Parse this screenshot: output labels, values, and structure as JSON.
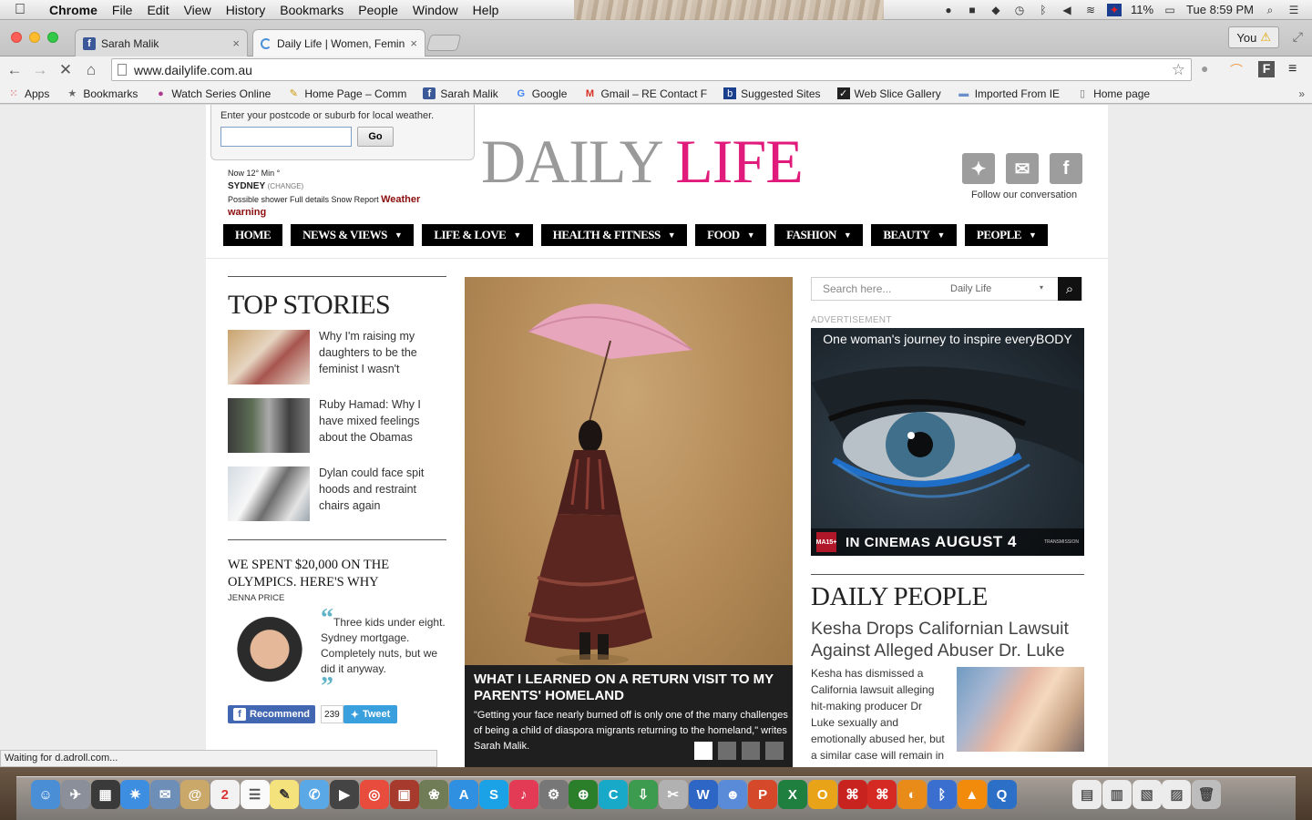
{
  "menubar": {
    "app": "Chrome",
    "items": [
      "File",
      "Edit",
      "View",
      "History",
      "Bookmarks",
      "People",
      "Window",
      "Help"
    ],
    "battery": "11%",
    "clock": "Tue 8:59 PM"
  },
  "tabs": [
    {
      "title": "Sarah Malik",
      "close": "×"
    },
    {
      "title": "Daily Life | Women, Femini",
      "close": "×"
    }
  ],
  "profile": {
    "label": "You"
  },
  "address": {
    "url": "www.dailylife.com.au"
  },
  "bookmarks": {
    "items": [
      {
        "label": "Apps",
        "icon": "apps-grid-icon"
      },
      {
        "label": "Bookmarks",
        "icon": "star-icon"
      },
      {
        "label": "Watch Series Online",
        "icon": "play-icon"
      },
      {
        "label": "Home Page – Comm",
        "icon": "pencil-icon"
      },
      {
        "label": "Sarah Malik",
        "icon": "facebook-icon"
      },
      {
        "label": "Google",
        "icon": "google-icon"
      },
      {
        "label": "Gmail – RE Contact F",
        "icon": "gmail-icon"
      },
      {
        "label": "Suggested Sites",
        "icon": "bing-icon"
      },
      {
        "label": "Web Slice Gallery",
        "icon": "web-slice-icon"
      },
      {
        "label": "Imported From IE",
        "icon": "folder-icon"
      },
      {
        "label": "Home page",
        "icon": "page-icon"
      }
    ],
    "more": "»"
  },
  "weather": {
    "prompt": "Enter your postcode or suburb for local weather.",
    "go": "Go",
    "now": "Now 12° Min °",
    "city": "SYDNEY",
    "change": "(CHANGE)",
    "forecast": "Possible shower Full details Snow Report",
    "warning": "Weather warning"
  },
  "logo": {
    "part1": "DAILY",
    "part2": "LIFE"
  },
  "social": {
    "follow": "Follow our conversation"
  },
  "nav": [
    "HOME",
    "NEWS & VIEWS",
    "LIFE & LOVE",
    "HEALTH & FITNESS",
    "FOOD",
    "FASHION",
    "BEAUTY",
    "PEOPLE"
  ],
  "top_stories": {
    "title_bold": "TOP",
    "title_rest": " STORIES",
    "items": [
      {
        "text": "Why I'm raising my daughters to be the feminist I wasn't"
      },
      {
        "text": "Ruby Hamad: Why I have mixed feelings about the Obamas"
      },
      {
        "text": "Dylan could face spit hoods and restraint chairs again"
      }
    ]
  },
  "opinion": {
    "title": "WE SPENT $20,000 ON THE OLYMPICS. HERE'S WHY",
    "author": "JENNA PRICE",
    "quote": "Three kids under eight. Sydney mortgage. Completely nuts, but we did it anyway.",
    "open_q": "“",
    "close_q": "”",
    "recommend": "Recommend",
    "count": "239",
    "tweet": "Tweet"
  },
  "hero": {
    "headline": "WHAT I LEARNED ON A RETURN VISIT TO MY PARENTS' HOMELAND",
    "sub": "\"Getting your face nearly burned off is only one of the many challenges of being a child of diaspora migrants returning to the homeland,\" writes Sarah Malik."
  },
  "search": {
    "placeholder": "Search here...",
    "scope": "Daily Life"
  },
  "ad": {
    "label": "ADVERTISEMENT",
    "tagline": "One woman's journey to inspire everyBODY",
    "rating": "MA15+",
    "cta": "IN CINEMAS",
    "date": "AUGUST 4",
    "brand": "TRANSMISSION"
  },
  "daily_people": {
    "title_bold": "DAILY",
    "title_rest": " PEOPLE",
    "headline": "Kesha Drops Californian Lawsuit Against Alleged Abuser Dr. Luke",
    "body": "Kesha has dismissed a California lawsuit alleging hit-making producer Dr Luke sexually and emotionally abused her, but a similar case will remain in"
  },
  "status": {
    "text": "Waiting for d.adroll.com..."
  }
}
